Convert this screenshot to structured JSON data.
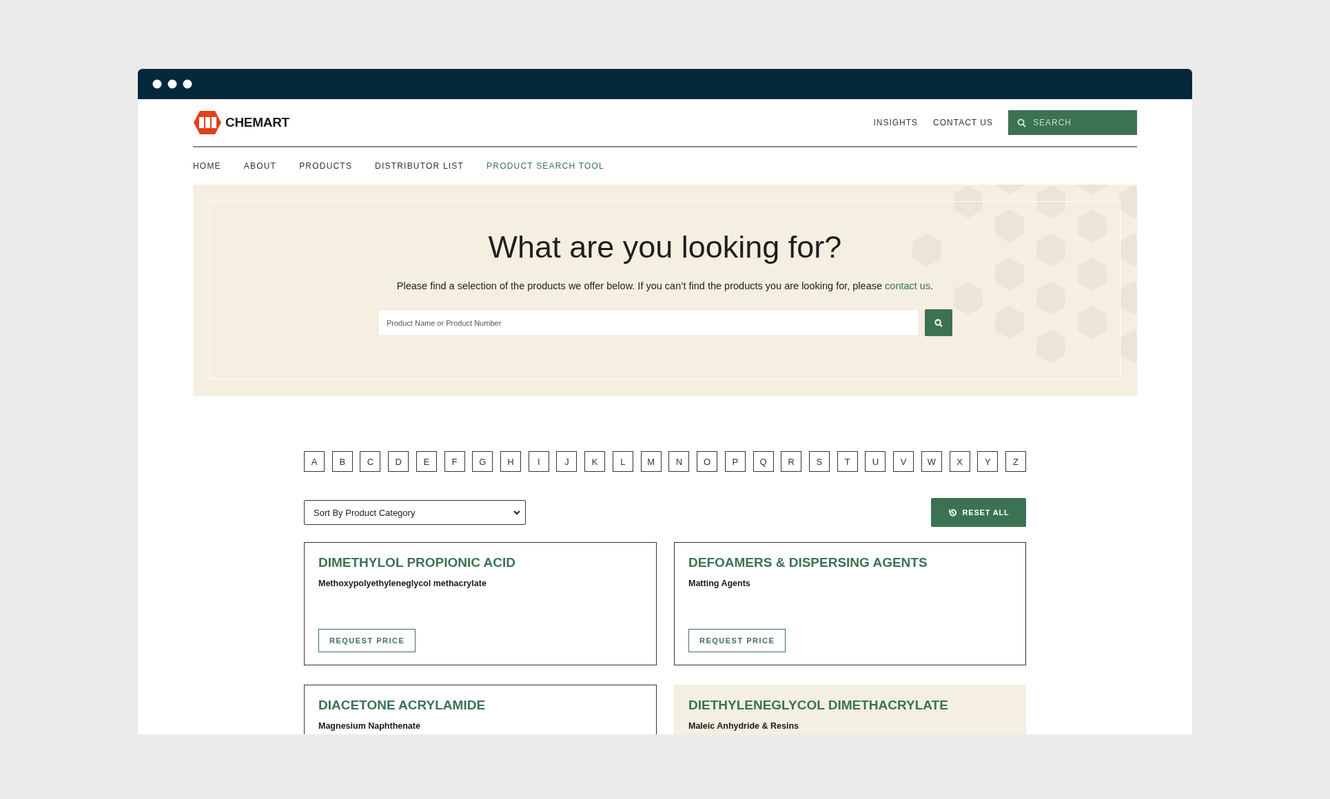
{
  "brand": {
    "name": "CHEMART"
  },
  "top_links": [
    {
      "label": "INSIGHTS"
    },
    {
      "label": "CONTACT US"
    }
  ],
  "header_search": {
    "placeholder": "SEARCH"
  },
  "nav": [
    {
      "label": "HOME",
      "selected": false
    },
    {
      "label": "ABOUT",
      "selected": false
    },
    {
      "label": "PRODUCTS",
      "selected": false
    },
    {
      "label": "DISTRIBUTOR LIST",
      "selected": false
    },
    {
      "label": "PRODUCT SEARCH TOOL",
      "selected": true
    }
  ],
  "hero": {
    "title": "What are you looking for?",
    "text": "Please find a selection of the products we offer below. If you can’t find the products you are looking for, please",
    "link": "contact us",
    "after": ".",
    "search": {
      "placeholder": "Product Name or Product Number"
    }
  },
  "letters": [
    "A",
    "B",
    "C",
    "D",
    "E",
    "F",
    "G",
    "H",
    "I",
    "J",
    "K",
    "L",
    "M",
    "N",
    "O",
    "P",
    "Q",
    "R",
    "S",
    "T",
    "U",
    "V",
    "W",
    "X",
    "Y",
    "Z"
  ],
  "sort": {
    "value": "Sort By Product Category"
  },
  "reset_button": "RESET ALL",
  "products": [
    {
      "name": "DIMETHYLOL PROPIONIC ACID",
      "category": "Methoxypolyethyleneglycol methacrylate",
      "button": "REQUEST PRICE",
      "highlighted": false
    },
    {
      "name": "DEFOAMERS & DISPERSING AGENTS",
      "category": "Matting Agents",
      "button": "REQUEST PRICE",
      "highlighted": false
    },
    {
      "name": "DIACETONE ACRYLAMIDE",
      "category": "Magnesium Naphthenate",
      "highlighted": false
    },
    {
      "name": "DIETHYLENEGLYCOL DIMETHACRYLATE",
      "category": "Maleic Anhydride & Resins",
      "highlighted": true
    }
  ]
}
